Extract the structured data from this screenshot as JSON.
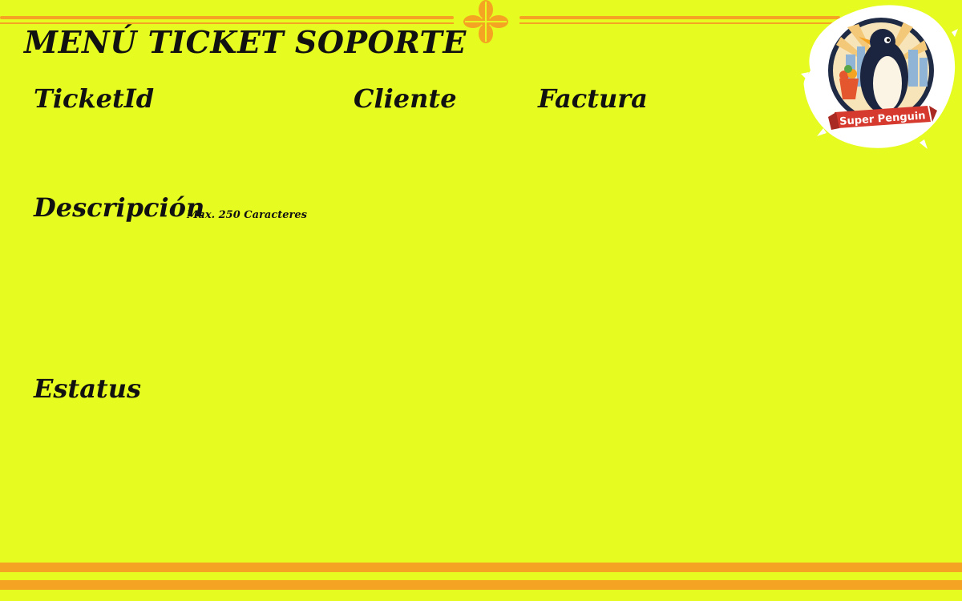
{
  "page": {
    "title": "MENÚ TICKET SOPORTE"
  },
  "fields": {
    "ticket_id_label": "TicketId",
    "cliente_label": "Cliente",
    "factura_label": "Factura",
    "descripcion_label": "Descripción",
    "descripcion_hint": "Max. 250 Caracteres",
    "estatus_label": "Estatus"
  },
  "logo": {
    "brand_name": "Super Penguin",
    "icon": "penguin-logo"
  },
  "decorations": {
    "ornament_icon": "orange-cross-ornament"
  },
  "colors": {
    "background": "#e6fb1f",
    "accent_orange": "#f5a323",
    "text": "#111111"
  }
}
